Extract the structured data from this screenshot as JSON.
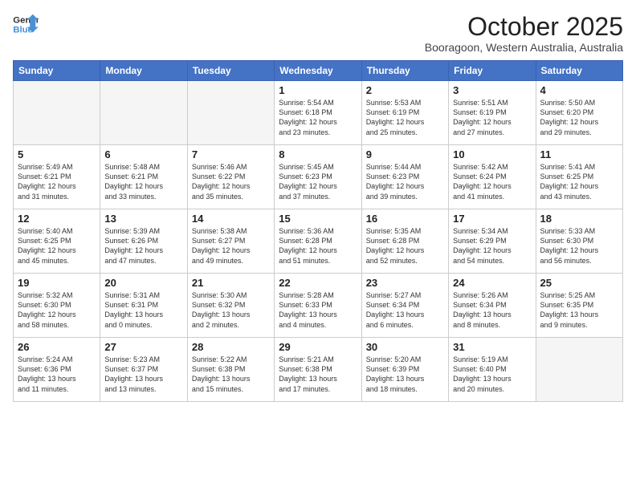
{
  "header": {
    "logo_line1": "General",
    "logo_line2": "Blue",
    "title": "October 2025",
    "subtitle": "Booragoon, Western Australia, Australia"
  },
  "days_of_week": [
    "Sunday",
    "Monday",
    "Tuesday",
    "Wednesday",
    "Thursday",
    "Friday",
    "Saturday"
  ],
  "weeks": [
    [
      {
        "day": "",
        "info": ""
      },
      {
        "day": "",
        "info": ""
      },
      {
        "day": "",
        "info": ""
      },
      {
        "day": "1",
        "info": "Sunrise: 5:54 AM\nSunset: 6:18 PM\nDaylight: 12 hours\nand 23 minutes."
      },
      {
        "day": "2",
        "info": "Sunrise: 5:53 AM\nSunset: 6:19 PM\nDaylight: 12 hours\nand 25 minutes."
      },
      {
        "day": "3",
        "info": "Sunrise: 5:51 AM\nSunset: 6:19 PM\nDaylight: 12 hours\nand 27 minutes."
      },
      {
        "day": "4",
        "info": "Sunrise: 5:50 AM\nSunset: 6:20 PM\nDaylight: 12 hours\nand 29 minutes."
      }
    ],
    [
      {
        "day": "5",
        "info": "Sunrise: 5:49 AM\nSunset: 6:21 PM\nDaylight: 12 hours\nand 31 minutes."
      },
      {
        "day": "6",
        "info": "Sunrise: 5:48 AM\nSunset: 6:21 PM\nDaylight: 12 hours\nand 33 minutes."
      },
      {
        "day": "7",
        "info": "Sunrise: 5:46 AM\nSunset: 6:22 PM\nDaylight: 12 hours\nand 35 minutes."
      },
      {
        "day": "8",
        "info": "Sunrise: 5:45 AM\nSunset: 6:23 PM\nDaylight: 12 hours\nand 37 minutes."
      },
      {
        "day": "9",
        "info": "Sunrise: 5:44 AM\nSunset: 6:23 PM\nDaylight: 12 hours\nand 39 minutes."
      },
      {
        "day": "10",
        "info": "Sunrise: 5:42 AM\nSunset: 6:24 PM\nDaylight: 12 hours\nand 41 minutes."
      },
      {
        "day": "11",
        "info": "Sunrise: 5:41 AM\nSunset: 6:25 PM\nDaylight: 12 hours\nand 43 minutes."
      }
    ],
    [
      {
        "day": "12",
        "info": "Sunrise: 5:40 AM\nSunset: 6:25 PM\nDaylight: 12 hours\nand 45 minutes."
      },
      {
        "day": "13",
        "info": "Sunrise: 5:39 AM\nSunset: 6:26 PM\nDaylight: 12 hours\nand 47 minutes."
      },
      {
        "day": "14",
        "info": "Sunrise: 5:38 AM\nSunset: 6:27 PM\nDaylight: 12 hours\nand 49 minutes."
      },
      {
        "day": "15",
        "info": "Sunrise: 5:36 AM\nSunset: 6:28 PM\nDaylight: 12 hours\nand 51 minutes."
      },
      {
        "day": "16",
        "info": "Sunrise: 5:35 AM\nSunset: 6:28 PM\nDaylight: 12 hours\nand 52 minutes."
      },
      {
        "day": "17",
        "info": "Sunrise: 5:34 AM\nSunset: 6:29 PM\nDaylight: 12 hours\nand 54 minutes."
      },
      {
        "day": "18",
        "info": "Sunrise: 5:33 AM\nSunset: 6:30 PM\nDaylight: 12 hours\nand 56 minutes."
      }
    ],
    [
      {
        "day": "19",
        "info": "Sunrise: 5:32 AM\nSunset: 6:30 PM\nDaylight: 12 hours\nand 58 minutes."
      },
      {
        "day": "20",
        "info": "Sunrise: 5:31 AM\nSunset: 6:31 PM\nDaylight: 13 hours\nand 0 minutes."
      },
      {
        "day": "21",
        "info": "Sunrise: 5:30 AM\nSunset: 6:32 PM\nDaylight: 13 hours\nand 2 minutes."
      },
      {
        "day": "22",
        "info": "Sunrise: 5:28 AM\nSunset: 6:33 PM\nDaylight: 13 hours\nand 4 minutes."
      },
      {
        "day": "23",
        "info": "Sunrise: 5:27 AM\nSunset: 6:34 PM\nDaylight: 13 hours\nand 6 minutes."
      },
      {
        "day": "24",
        "info": "Sunrise: 5:26 AM\nSunset: 6:34 PM\nDaylight: 13 hours\nand 8 minutes."
      },
      {
        "day": "25",
        "info": "Sunrise: 5:25 AM\nSunset: 6:35 PM\nDaylight: 13 hours\nand 9 minutes."
      }
    ],
    [
      {
        "day": "26",
        "info": "Sunrise: 5:24 AM\nSunset: 6:36 PM\nDaylight: 13 hours\nand 11 minutes."
      },
      {
        "day": "27",
        "info": "Sunrise: 5:23 AM\nSunset: 6:37 PM\nDaylight: 13 hours\nand 13 minutes."
      },
      {
        "day": "28",
        "info": "Sunrise: 5:22 AM\nSunset: 6:38 PM\nDaylight: 13 hours\nand 15 minutes."
      },
      {
        "day": "29",
        "info": "Sunrise: 5:21 AM\nSunset: 6:38 PM\nDaylight: 13 hours\nand 17 minutes."
      },
      {
        "day": "30",
        "info": "Sunrise: 5:20 AM\nSunset: 6:39 PM\nDaylight: 13 hours\nand 18 minutes."
      },
      {
        "day": "31",
        "info": "Sunrise: 5:19 AM\nSunset: 6:40 PM\nDaylight: 13 hours\nand 20 minutes."
      },
      {
        "day": "",
        "info": ""
      }
    ]
  ]
}
